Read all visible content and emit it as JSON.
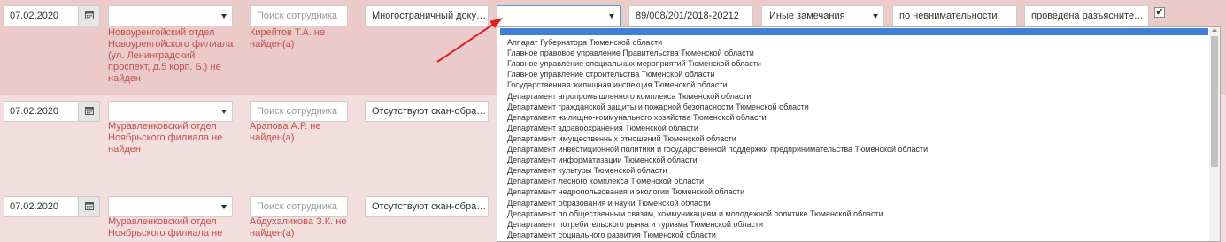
{
  "rows": [
    {
      "date": "07.02.2020",
      "select_value": "",
      "select_error": "Новоуренгойский отдел Новоуренгойского филиала (ул. Ленинградский проспект, д.5 корп. Б.) не найден",
      "employee_placeholder": "Поиск сотрудника",
      "employee_error": "Кирейтов Т.А. не найден(а)",
      "doc_value": "Многостраничный докум..."
    },
    {
      "date": "07.02.2020",
      "select_value": "",
      "select_error": "Муравленковский отдел Ноябрьского филиала не найден",
      "employee_placeholder": "Поиск сотрудника",
      "employee_error": "Арапова А.Р. не найден(а)",
      "doc_value": "Отсутствуют скан-образы..."
    },
    {
      "date": "07.02.2020",
      "select_value": "",
      "select_error": "Муравленковский отдел Ноябрьского филиала не",
      "employee_placeholder": "Поиск сотрудника",
      "employee_error": "Абдухаликова З.К. не найден(а)",
      "doc_value": "Отсутствуют скан-образы..."
    }
  ],
  "row1_extra": {
    "org_select_value": "",
    "reg_number": "89/008/201/2018-20212",
    "remark_type": "Иные замечания",
    "reason": "по невнимательности",
    "action": "проведена разъяснитель...",
    "checked": "✔"
  },
  "dropdown_items": [
    "Аппарат Губернатора Тюменской области",
    "Главное правовое управление Правительства Тюменской области",
    "Главное управление специальных мероприятий Тюменской области",
    "Главное управление строительства Тюменской области",
    "Государственная жилищная инспекция Тюменской области",
    "Департамент агропромышленного комплекса Тюменской области",
    "Департамент гражданской защиты и пожарной безопасности Тюменской области",
    "Департамент жилищно-коммунального хозяйства Тюменской области",
    "Департамент здравоохранения Тюменской области",
    "Департамент имущественных отношений Тюменской области",
    "Департамент инвестиционной политики и государственной поддержки предпринимательства Тюменской области",
    "Департамент информатизации Тюменской области",
    "Департамент культуры Тюменской области",
    "Департамент лесного комплекса Тюменской области",
    "Департамент недропользования и экологии Тюменской области",
    "Департамент образования и науки Тюменской области",
    "Департамент по общественным связям, коммуникациям и молодежной политике Тюменской области",
    "Департамент потребительского рынка и туризма Тюменской области",
    "Департамент социального развития Тюменской области"
  ],
  "colors": {
    "annotation_arrow": "#e02020",
    "error_text": "#c0504d",
    "highlight": "#3f7fd9"
  }
}
